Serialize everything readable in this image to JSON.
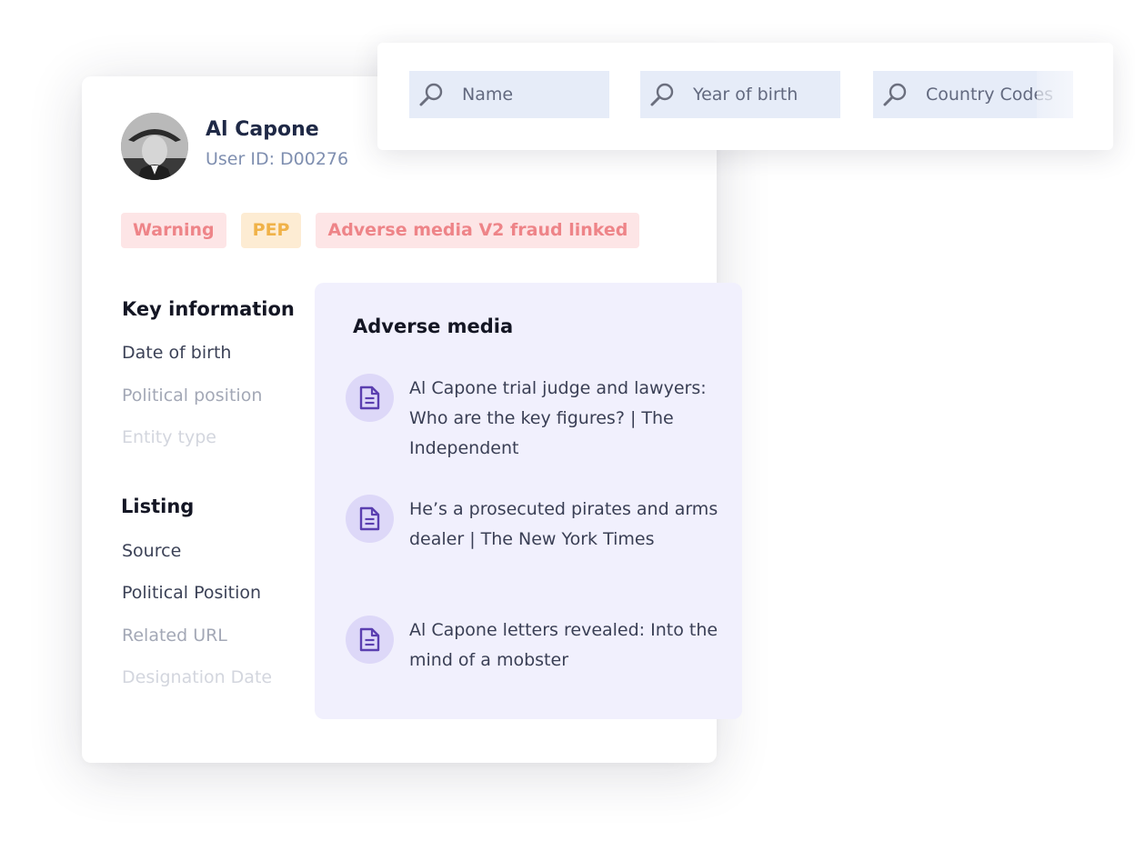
{
  "profile": {
    "name": "Al Capone",
    "user_id": "User ID: D00276",
    "tags": [
      "Warning",
      "PEP",
      "Adverse media V2 fraud linked"
    ],
    "key_information": {
      "title": "Key information",
      "fields": [
        "Date of birth",
        "Political position",
        "Entity type"
      ]
    },
    "listing": {
      "title": "Listing",
      "fields": [
        "Source",
        "Political Position",
        "Related URL",
        "Designation Date"
      ]
    }
  },
  "search": {
    "fields": [
      {
        "placeholder": "Name",
        "icon": "search-icon"
      },
      {
        "placeholder": "Year of birth",
        "icon": "search-icon"
      },
      {
        "placeholder": "Country Codes",
        "icon": "search-icon"
      }
    ]
  },
  "adverse_media": {
    "title": "Adverse media",
    "items": [
      {
        "text": "Al Capone trial judge and lawyers: Who are the key figures? | The Independent",
        "icon": "document-icon"
      },
      {
        "text": "He’s a prosecuted pirates and arms dealer | The New York Times",
        "icon": "document-icon"
      },
      {
        "text": "Al Capone letters revealed: Into the mind of a mobster",
        "icon": "document-icon"
      }
    ]
  },
  "colors": {
    "tag_warning_bg": "#fde5e6",
    "tag_warning_text": "#ee8488",
    "tag_pep_bg": "#fdecd3",
    "tag_pep_text": "#f0b248",
    "search_field_bg": "#e6ecf8",
    "media_panel_bg": "#f1f0fd",
    "media_icon_color": "#5b3fb0"
  }
}
